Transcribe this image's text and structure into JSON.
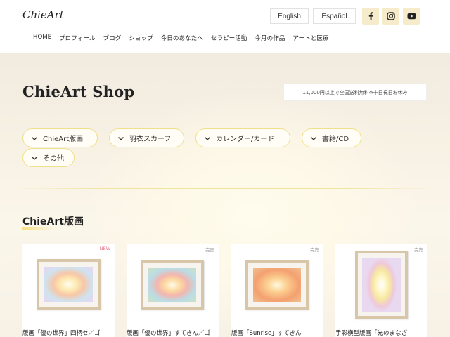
{
  "header": {
    "logo": "ChieArt",
    "lang_en": "English",
    "lang_es": "Español",
    "social": [
      {
        "icon": "facebook-icon"
      },
      {
        "icon": "instagram-icon"
      },
      {
        "icon": "youtube-icon"
      }
    ]
  },
  "nav": [
    "HOME",
    "プロフィール",
    "ブログ",
    "ショップ",
    "今日のあなたへ",
    "セラピー活動",
    "今月の作品",
    "アートと医療"
  ],
  "page": {
    "title": "ChieArt Shop",
    "notice": "11,000円以上で全国送料無料※十日祝日お休み"
  },
  "categories": [
    "ChieArt版画",
    "羽衣スカーフ",
    "カレンダー/カード",
    "書籍/CD",
    "その他"
  ],
  "section": {
    "title": "ChieArt版画"
  },
  "products": [
    {
      "badge": "NEW",
      "caption": "版画「優の世界」四柄セ／ゴ"
    },
    {
      "badge": "完売",
      "caption": "版画「優の世界」すてきん／ゴ"
    },
    {
      "badge": "完売",
      "caption": "版画「Sunrise」すてきん"
    },
    {
      "badge": "完売",
      "caption": "手彩横型版画「光のまなざ"
    }
  ],
  "colors": {
    "accent_yellow": "#f0e08a",
    "social_bg": "#f6eccb",
    "new_badge": "#e8748c"
  }
}
